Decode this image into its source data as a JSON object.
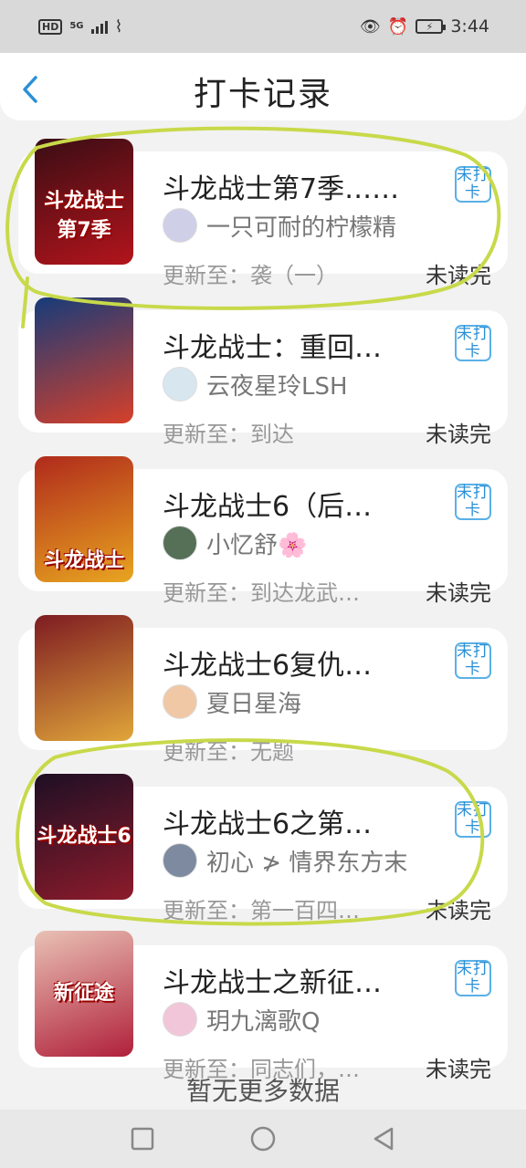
{
  "status_bar": {
    "hd": "HD",
    "network": "5G",
    "time": "3:44"
  },
  "header": {
    "back_icon": "chevron-left-icon",
    "title": "打卡记录"
  },
  "accent_color": "#2b8fd6",
  "annotation_color": "#c8d94a",
  "cards": [
    {
      "title": "斗龙战士第7季……",
      "author": "一只可耐的柠檬精",
      "update": "更新至：袭（一）",
      "status": "未读完",
      "checkin_label": "未打卡",
      "cover_text": "斗龙战士 第7季",
      "cover_colors": [
        "#3a0d14",
        "#b3141c"
      ],
      "avatar_color": "#cfcfe8"
    },
    {
      "title": "斗龙战士：重回…",
      "author": "云夜星玲LSH",
      "update": "更新至：到达",
      "status": "未读完",
      "checkin_label": "未打卡",
      "cover_text": "",
      "cover_colors": [
        "#163b7a",
        "#d6402a"
      ],
      "avatar_color": "#d8e6ef"
    },
    {
      "title": "斗龙战士6（后…",
      "author": "小忆舒🌸",
      "update": "更新至：到达龙武…",
      "status": "未读完",
      "checkin_label": "未打卡",
      "cover_text": "斗龙战士",
      "cover_colors": [
        "#b02a1c",
        "#e8a520"
      ],
      "avatar_color": "#557057"
    },
    {
      "title": "斗龙战士6复仇…",
      "author": "夏日星海",
      "update": "更新至：无题",
      "status": "",
      "checkin_label": "未打卡",
      "cover_text": "",
      "cover_colors": [
        "#7e1b22",
        "#e0a63a"
      ],
      "avatar_color": "#f0c8a6"
    },
    {
      "title": "斗龙战士6之第…",
      "author": "初心 ≯ 情界东方末",
      "update": "更新至：第一百四…",
      "status": "未读完",
      "checkin_label": "未打卡",
      "cover_text": "斗龙战士6",
      "cover_colors": [
        "#1e0f24",
        "#8c1b2b"
      ],
      "avatar_color": "#7d8aa0"
    },
    {
      "title": "斗龙战士之新征…",
      "author": "玥九漓歌Q",
      "update": "更新至：同志们，…",
      "status": "未读完",
      "checkin_label": "未打卡",
      "cover_text": "新征途",
      "cover_colors": [
        "#e9c1b5",
        "#b0203a"
      ],
      "avatar_color": "#f2c6d9"
    }
  ],
  "footer_text": "暂无更多数据",
  "nav": {
    "recent": "square-icon",
    "home": "circle-icon",
    "back": "triangle-back-icon"
  }
}
